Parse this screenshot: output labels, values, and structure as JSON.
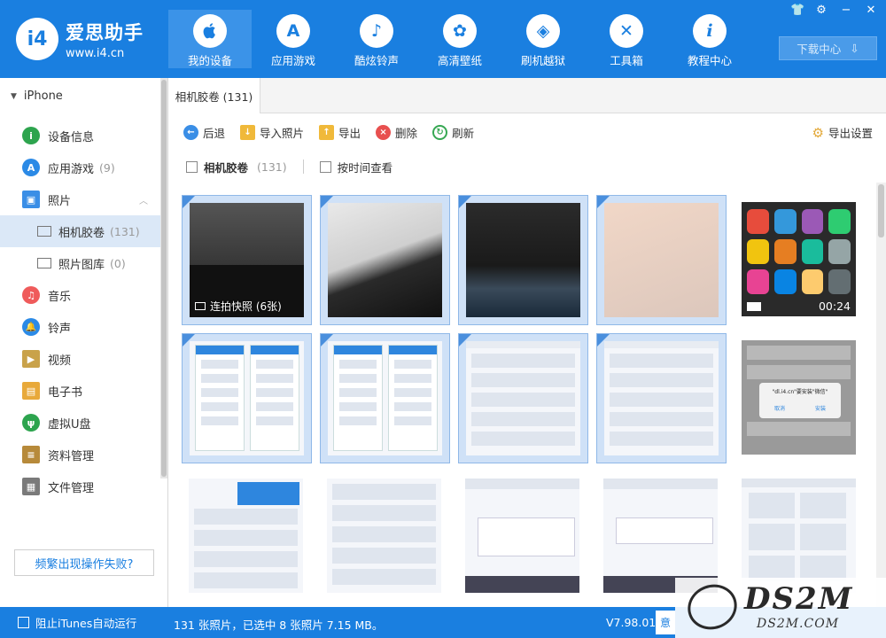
{
  "app": {
    "name": "爱思助手",
    "url": "www.i4.cn",
    "logo_glyph": "i4"
  },
  "nav": [
    {
      "label": "我的设备",
      "icon": "apple-icon",
      "glyph": ""
    },
    {
      "label": "应用游戏",
      "icon": "appstore-icon",
      "glyph": "A"
    },
    {
      "label": "酷炫铃声",
      "icon": "bell-icon",
      "glyph": "♪"
    },
    {
      "label": "高清壁纸",
      "icon": "flower-icon",
      "glyph": "✿"
    },
    {
      "label": "刷机越狱",
      "icon": "box-icon",
      "glyph": "◈"
    },
    {
      "label": "工具箱",
      "icon": "tools-icon",
      "glyph": "✕"
    },
    {
      "label": "教程中心",
      "icon": "info-icon",
      "glyph": "i"
    }
  ],
  "window_controls": {
    "shirt": "👕",
    "gear": "⚙",
    "min": "−",
    "close": "✕"
  },
  "download_center": {
    "label": "下载中心",
    "glyph": "⇩"
  },
  "sidebar": {
    "device": "iPhone",
    "items": [
      {
        "label": "设备信息",
        "count": "",
        "color": "#2da44e",
        "glyph": "i"
      },
      {
        "label": "应用游戏",
        "count": "(9)",
        "color": "#2b8ae6",
        "glyph": "A"
      },
      {
        "label": "照片",
        "count": "",
        "color": "#3a8ee6",
        "glyph": "▣"
      },
      {
        "label": "相机胶卷",
        "count": "(131)",
        "color": "",
        "glyph": ""
      },
      {
        "label": "照片图库",
        "count": "(0)",
        "color": "",
        "glyph": ""
      },
      {
        "label": "音乐",
        "count": "",
        "color": "#ef5b5b",
        "glyph": "♫"
      },
      {
        "label": "铃声",
        "count": "",
        "color": "#2b8ae6",
        "glyph": "🔔"
      },
      {
        "label": "视频",
        "count": "",
        "color": "#c9a24a",
        "glyph": "▶"
      },
      {
        "label": "电子书",
        "count": "",
        "color": "#e8a93a",
        "glyph": "▤"
      },
      {
        "label": "虚拟U盘",
        "count": "",
        "color": "#2da44e",
        "glyph": "ψ"
      },
      {
        "label": "资料管理",
        "count": "",
        "color": "#b78a3a",
        "glyph": "≡"
      },
      {
        "label": "文件管理",
        "count": "",
        "color": "#7a7a7a",
        "glyph": "▦"
      }
    ],
    "fail_button": "频繁出现操作失败?"
  },
  "tab": {
    "label": "相机胶卷 (131)"
  },
  "toolbar": {
    "back": "后退",
    "import": "导入照片",
    "export": "导出",
    "delete": "删除",
    "refresh": "刷新",
    "export_settings": "导出设置"
  },
  "filter": {
    "all_label": "相机胶卷",
    "all_count": "(131)",
    "by_time": "按时间查看"
  },
  "photos": {
    "burst_label": "连拍快照 (6张)",
    "video_duration": "00:24",
    "dialog_title": "\"dl.i4.cn\"要安装\"微信\"",
    "dialog_cancel": "取消",
    "dialog_install": "安装"
  },
  "status": {
    "itunes_label": "阻止iTunes自动运行",
    "summary": "131 张照片，已选中 8 张照片 7.15 MB。",
    "version": "V7.98.01",
    "btn": "意"
  },
  "watermark": {
    "big": "DS2M",
    "small": "DS2M.COM"
  }
}
